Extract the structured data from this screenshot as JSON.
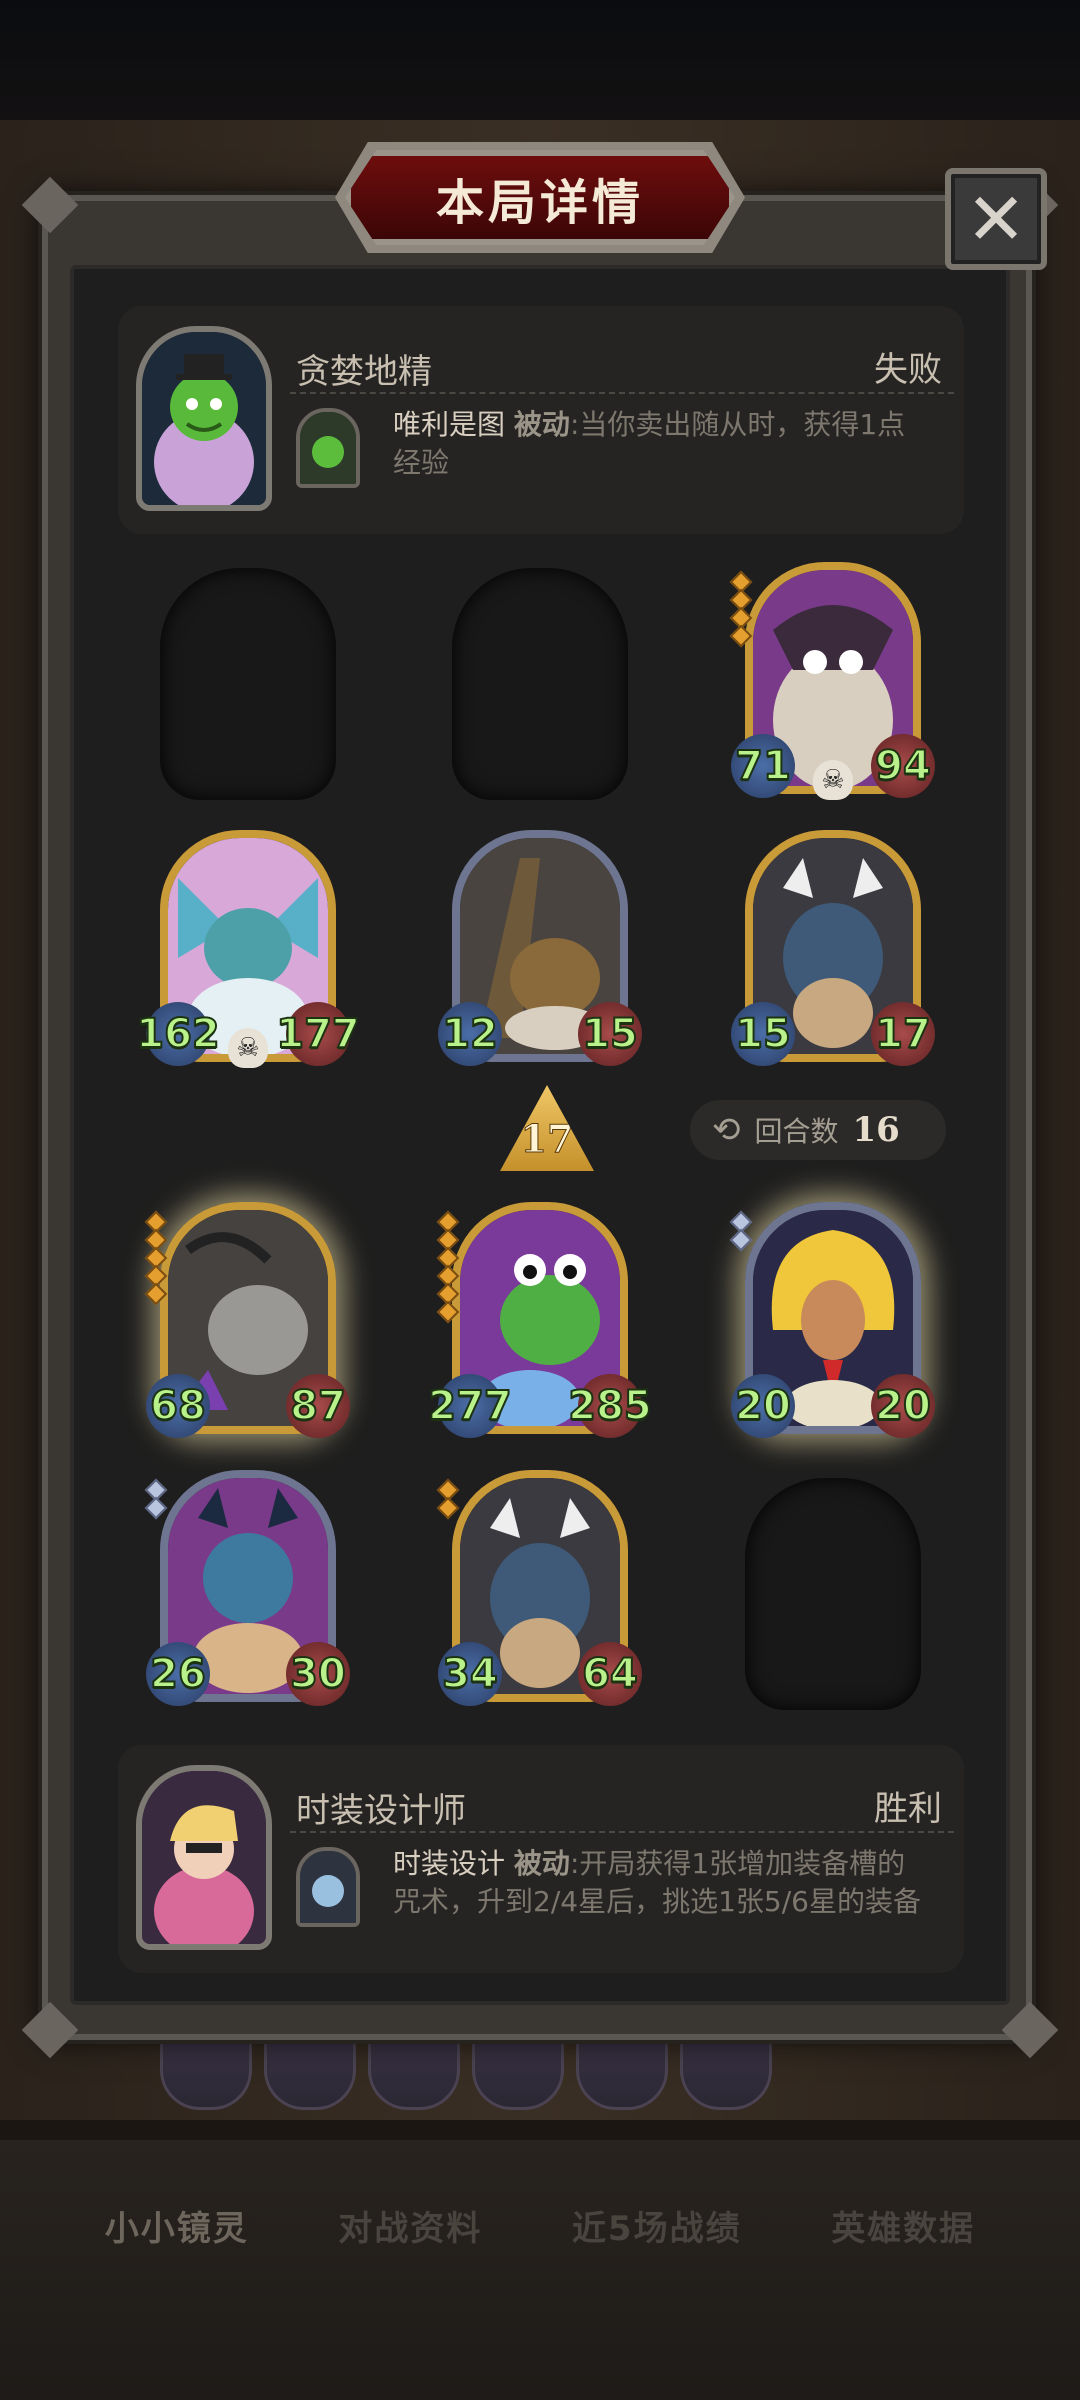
{
  "title": "本局详情",
  "close_label": "✕",
  "top_player": {
    "name": "贪婪地精",
    "result": "失败",
    "ability_name": "唯利是图",
    "ability_tag": "被动",
    "ability_desc": ":当你卖出随从时，获得1点经验"
  },
  "bottom_player": {
    "name": "时装设计师",
    "result": "胜利",
    "ability_name": "时装设计",
    "ability_tag": "被动",
    "ability_desc": ":开局获得1张增加装备槽的咒术，升到2/4星后，挑选1张5/6星的装备"
  },
  "tier": "17",
  "round": {
    "label": "回合数",
    "value": "16"
  },
  "top_board": [
    {
      "attack": "71",
      "health": "94",
      "stars": 4,
      "skull": true,
      "frame": "gold",
      "art": "owl"
    },
    {
      "attack": "162",
      "health": "177",
      "stars": 0,
      "skull": true,
      "frame": "gold",
      "art": "fishfrog"
    },
    {
      "attack": "12",
      "health": "15",
      "stars": 0,
      "skull": false,
      "frame": "silver",
      "art": "dragon-head"
    },
    {
      "attack": "15",
      "health": "17",
      "stars": 0,
      "skull": false,
      "frame": "gold",
      "art": "demon"
    }
  ],
  "bottom_board": [
    {
      "attack": "68",
      "health": "87",
      "stars": 5,
      "skull": false,
      "frame": "gold",
      "art": "grey-dragon",
      "glow": true
    },
    {
      "attack": "277",
      "health": "285",
      "stars": 6,
      "skull": false,
      "frame": "gold",
      "art": "croc"
    },
    {
      "attack": "20",
      "health": "20",
      "stars": 2,
      "star_color": "silver",
      "skull": false,
      "frame": "silver",
      "art": "fire-witch",
      "glow": true
    },
    {
      "attack": "26",
      "health": "30",
      "stars": 2,
      "star_color": "silver",
      "skull": false,
      "frame": "silver",
      "art": "blue-dragon"
    },
    {
      "attack": "34",
      "health": "64",
      "stars": 2,
      "skull": false,
      "frame": "gold",
      "art": "demon"
    }
  ],
  "bottom_tabs": [
    "小小镜灵",
    "对战资料",
    "近5场战绩",
    "英雄数据"
  ],
  "colors": {
    "gold_frame": "#c99a38",
    "silver_frame": "#6e7590",
    "stat_text": "#b9f28a",
    "title_banner": "#6e0d0d"
  }
}
